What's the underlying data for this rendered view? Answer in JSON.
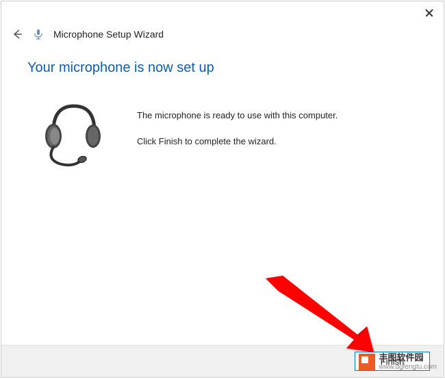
{
  "window": {
    "title": "Microphone Setup Wizard"
  },
  "content": {
    "heading": "Your microphone is now set up",
    "line1": "The microphone is ready to use with this computer.",
    "line2": "Click Finish to complete the wizard."
  },
  "footer": {
    "finish_label": "Finish"
  },
  "watermark": {
    "main": "丰图软件园",
    "sub": "www.dgfengtu.com"
  }
}
